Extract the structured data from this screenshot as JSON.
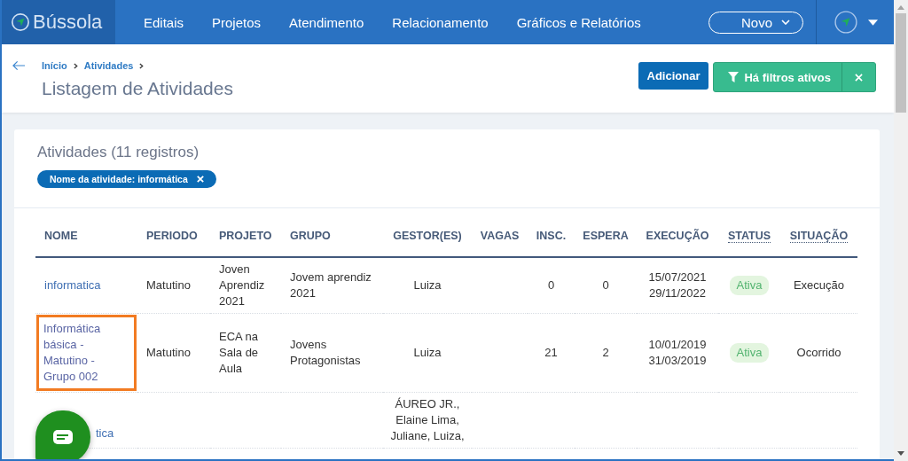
{
  "navbar": {
    "brand": "Bússola",
    "menu": [
      "Editais",
      "Projetos",
      "Atendimento",
      "Relacionamento",
      "Gráficos e Relatórios"
    ],
    "new_button": "Novo"
  },
  "header": {
    "breadcrumbs": [
      "Início",
      "Atividades"
    ],
    "title": "Listagem de Atividades",
    "add_button": "Adicionar",
    "filter_button": "Há filtros ativos"
  },
  "card": {
    "title": "Atividades (11 registros)",
    "filter_chip": "Nome da atividade: informática"
  },
  "table": {
    "columns": [
      "NOME",
      "PERIODO",
      "PROJETO",
      "GRUPO",
      "GESTOR(ES)",
      "VAGAS",
      "INSC.",
      "ESPERA",
      "EXECUÇÃO",
      "STATUS",
      "SITUAÇÃO"
    ],
    "rows": [
      {
        "nome": "informatica",
        "highlighted": false,
        "periodo": "Matutino",
        "projeto": "Joven Aprendiz 2021",
        "grupo": "Jovem aprendiz 2021",
        "gestores": "Luiza",
        "insc": "0",
        "espera": "0",
        "execucao": [
          "15/07/2021",
          "29/11/2022"
        ],
        "status": "Ativa",
        "situacao": "Execução"
      },
      {
        "nome": "Informática básica - Matutino - Grupo 002",
        "highlighted": true,
        "periodo": "Matutino",
        "projeto": "ECA na Sala de Aula",
        "grupo": "Jovens Protagonistas",
        "gestores": "Luiza",
        "insc": "21",
        "espera": "2",
        "execucao": [
          "10/01/2019",
          "31/03/2019"
        ],
        "status": "Ativa",
        "situacao": "Ocorrido"
      },
      {
        "nome": "tica",
        "highlighted": false,
        "behind_chat_button": true,
        "gestores": "ÁUREO JR., Elaine Lima, Juliane, Luiza,"
      }
    ]
  }
}
